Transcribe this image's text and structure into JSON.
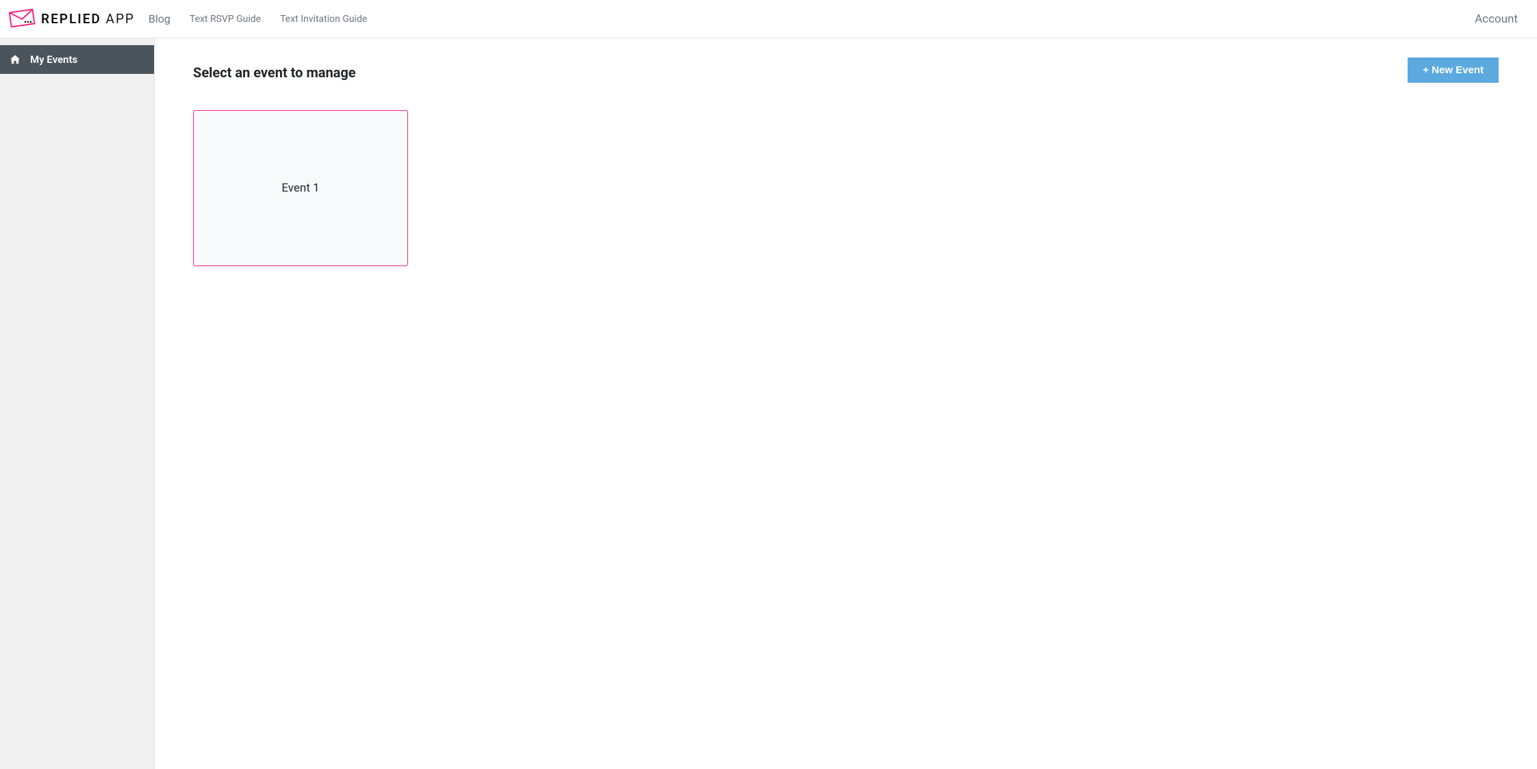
{
  "brand": {
    "name_primary": "REPLIED",
    "name_suffix": "APP"
  },
  "topnav": {
    "links": [
      {
        "label": "Blog"
      },
      {
        "label": "Text RSVP Guide"
      },
      {
        "label": "Text Invitation Guide"
      }
    ],
    "account_label": "Account"
  },
  "sidebar": {
    "items": [
      {
        "label": "My Events",
        "icon": "home-icon",
        "active": true
      }
    ]
  },
  "main": {
    "title": "Select an event to manage",
    "new_event_button": "+ New Event",
    "events": [
      {
        "name": "Event 1"
      }
    ]
  },
  "colors": {
    "accent_pink": "#f72585",
    "button_blue": "#5ca9df",
    "sidebar_active_bg": "#4b545c"
  }
}
